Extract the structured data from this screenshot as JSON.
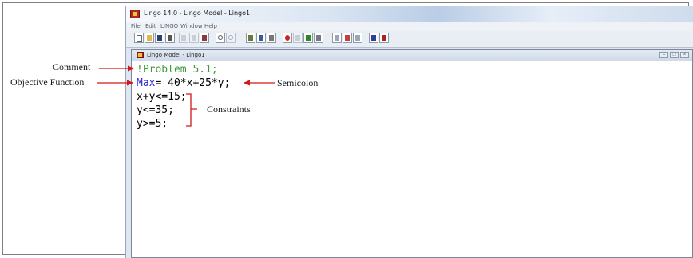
{
  "app": {
    "title": "Lingo 14.0 - Lingo Model - Lingo1",
    "menu": [
      "File",
      "Edit",
      "LINGO",
      "Window",
      "Help"
    ]
  },
  "toolbar": {
    "buttons": [
      "new",
      "open",
      "save",
      "print",
      "cut",
      "copy",
      "paste",
      "undo",
      "redo",
      "find",
      "go-to-line",
      "match-parenthesis",
      "solve",
      "solution",
      "options",
      "close-all",
      "tile",
      "cascade",
      "help",
      "context-help"
    ]
  },
  "model_window": {
    "title": "Lingo Model - Lingo1",
    "controls": [
      "minimize",
      "maximize",
      "close"
    ]
  },
  "code": {
    "comment": "!Problem 5.1;",
    "objective_keyword": "Max",
    "objective_rest": "= 40*x+25*y;",
    "constraints": [
      "x+y<=15;",
      "y<=35;",
      "y>=5;"
    ]
  },
  "annotations": {
    "comment": "Comment",
    "objective": "Objective Function",
    "semicolon": "Semicolon",
    "constraints": "Constraints"
  },
  "colors": {
    "comment": "#3f9a3a",
    "keyword": "#2b2bd8",
    "arrow": "#d01818"
  }
}
